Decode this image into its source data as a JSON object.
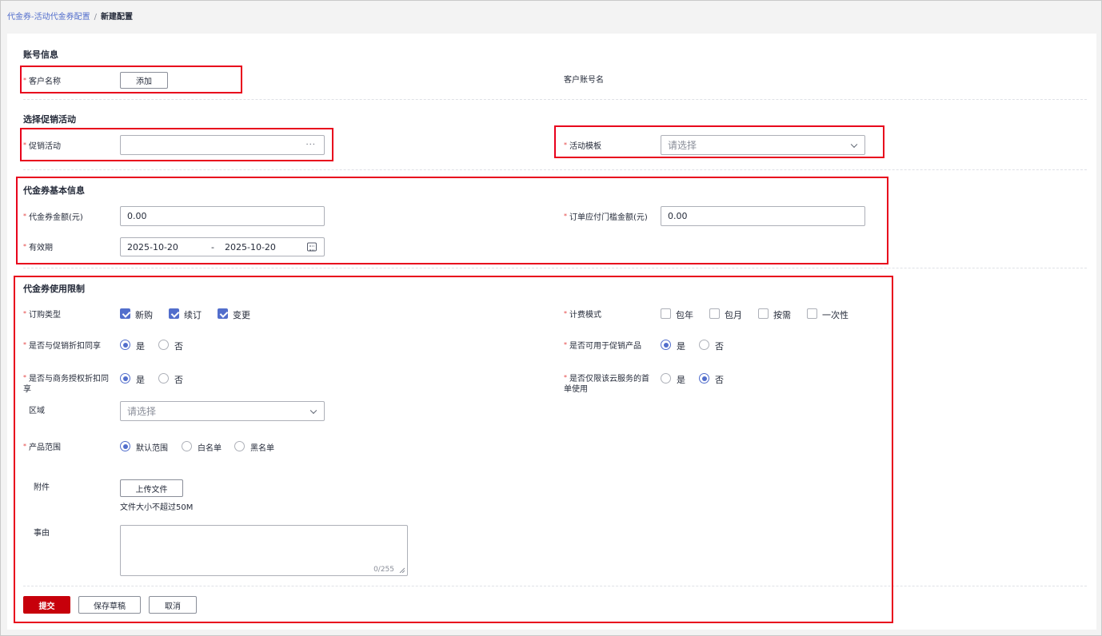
{
  "breadcrumb": {
    "parent": "代金券-活动代金券配置",
    "separator": "/",
    "current": "新建配置"
  },
  "account": {
    "title": "账号信息",
    "customer_name_label": "客户名称",
    "add_button": "添加",
    "account_name_label": "客户账号名"
  },
  "promotion": {
    "title": "选择促销活动",
    "activity_label": "促销活动",
    "activity_value": "",
    "activity_dots": "···",
    "template_label": "活动模板",
    "template_placeholder": "请选择"
  },
  "basic": {
    "title": "代金券基本信息",
    "amount_label": "代金券金额(元)",
    "amount_value": "0.00",
    "threshold_label": "订单应付门槛金额(元)",
    "threshold_value": "0.00",
    "validity_label": "有效期",
    "start_date": "2025-10-20",
    "range_sep": "-",
    "end_date": "2025-10-20"
  },
  "usage": {
    "title": "代金券使用限制",
    "order_type_label": "订购类型",
    "order_types": [
      {
        "label": "新购",
        "checked": true
      },
      {
        "label": "续订",
        "checked": true
      },
      {
        "label": "变更",
        "checked": true
      }
    ],
    "billing_label": "计费模式",
    "billing_modes": [
      {
        "label": "包年",
        "checked": false
      },
      {
        "label": "包月",
        "checked": false
      },
      {
        "label": "按需",
        "checked": false
      },
      {
        "label": "一次性",
        "checked": false
      }
    ],
    "share_promo_label": "是否与促销折扣同享",
    "share_promo": {
      "yes": "是",
      "no": "否",
      "selected": "yes"
    },
    "promo_product_label": "是否可用于促销产品",
    "promo_product": {
      "yes": "是",
      "no": "否",
      "selected": "yes"
    },
    "share_biz_label_1": "是否与商务授权折扣同",
    "share_biz_label_2": "享",
    "share_biz": {
      "yes": "是",
      "no": "否",
      "selected": "yes"
    },
    "first_order_label_1": "是否仅限该云服务的首",
    "first_order_label_2": "单使用",
    "first_order": {
      "yes": "是",
      "no": "否",
      "selected": "no"
    },
    "region_label": "区域",
    "region_placeholder": "请选择",
    "product_scope_label": "产品范围",
    "product_scope": {
      "options": [
        "默认范围",
        "白名单",
        "黑名单"
      ],
      "selected": "默认范围"
    },
    "attachment_label": "附件",
    "upload_button": "上传文件",
    "upload_hint": "文件大小不超过50M",
    "reason_label": "事由",
    "reason_value": "",
    "reason_counter": "0/255"
  },
  "actions": {
    "submit": "提交",
    "save_draft": "保存草稿",
    "cancel": "取消"
  },
  "colors": {
    "accent": "#526ecc",
    "primary_button": "#c7000b",
    "highlight_box": "#e8001c",
    "required": "#e54545"
  }
}
